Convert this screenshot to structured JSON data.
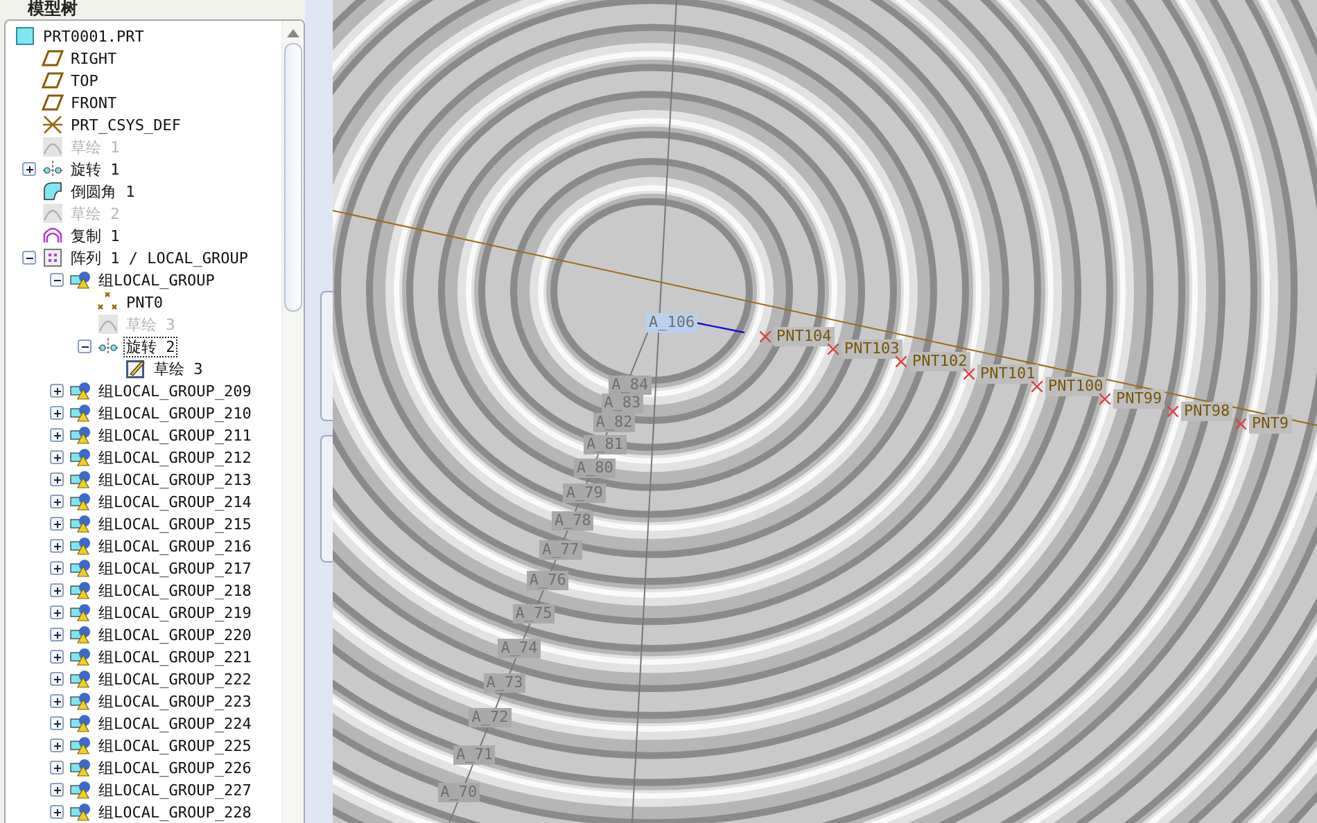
{
  "model_tree": {
    "header": "模型树",
    "items": [
      {
        "label": "PRT0001.PRT",
        "kind": "part",
        "dimmed": false,
        "selected": false,
        "children": [
          {
            "label": "RIGHT",
            "kind": "plane",
            "dimmed": false,
            "selected": false
          },
          {
            "label": "TOP",
            "kind": "plane",
            "dimmed": false,
            "selected": false
          },
          {
            "label": "FRONT",
            "kind": "plane",
            "dimmed": false,
            "selected": false
          },
          {
            "label": "PRT_CSYS_DEF",
            "kind": "csys",
            "dimmed": false,
            "selected": false
          },
          {
            "label": "草绘 1",
            "kind": "sketch",
            "dimmed": true,
            "selected": false
          },
          {
            "label": "旋转 1",
            "kind": "revolve",
            "dimmed": false,
            "selected": false,
            "expanded": false
          },
          {
            "label": "倒圆角 1",
            "kind": "round",
            "dimmed": false,
            "selected": false
          },
          {
            "label": "草绘 2",
            "kind": "sketch",
            "dimmed": true,
            "selected": false
          },
          {
            "label": "复制 1",
            "kind": "copy",
            "dimmed": false,
            "selected": false
          },
          {
            "label": "阵列 1 / LOCAL_GROUP",
            "kind": "pattern",
            "dimmed": false,
            "selected": false,
            "expanded": true,
            "children": [
              {
                "label": "组LOCAL_GROUP",
                "kind": "group",
                "dimmed": false,
                "selected": false,
                "expanded": true,
                "children": [
                  {
                    "label": "PNT0",
                    "kind": "point",
                    "dimmed": false,
                    "selected": false
                  },
                  {
                    "label": "草绘 3",
                    "kind": "sketch",
                    "dimmed": true,
                    "selected": false
                  },
                  {
                    "label": "旋转 2",
                    "kind": "revolve",
                    "dimmed": false,
                    "selected": true,
                    "expanded": true,
                    "children": [
                      {
                        "label": "草绘 3",
                        "kind": "sketch_edit",
                        "dimmed": false,
                        "selected": false
                      }
                    ]
                  }
                ]
              },
              {
                "label": "组LOCAL_GROUP_209",
                "kind": "group",
                "dimmed": false,
                "selected": false,
                "expanded": false
              },
              {
                "label": "组LOCAL_GROUP_210",
                "kind": "group",
                "dimmed": false,
                "selected": false,
                "expanded": false
              },
              {
                "label": "组LOCAL_GROUP_211",
                "kind": "group",
                "dimmed": false,
                "selected": false,
                "expanded": false
              },
              {
                "label": "组LOCAL_GROUP_212",
                "kind": "group",
                "dimmed": false,
                "selected": false,
                "expanded": false
              },
              {
                "label": "组LOCAL_GROUP_213",
                "kind": "group",
                "dimmed": false,
                "selected": false,
                "expanded": false
              },
              {
                "label": "组LOCAL_GROUP_214",
                "kind": "group",
                "dimmed": false,
                "selected": false,
                "expanded": false
              },
              {
                "label": "组LOCAL_GROUP_215",
                "kind": "group",
                "dimmed": false,
                "selected": false,
                "expanded": false
              },
              {
                "label": "组LOCAL_GROUP_216",
                "kind": "group",
                "dimmed": false,
                "selected": false,
                "expanded": false
              },
              {
                "label": "组LOCAL_GROUP_217",
                "kind": "group",
                "dimmed": false,
                "selected": false,
                "expanded": false
              },
              {
                "label": "组LOCAL_GROUP_218",
                "kind": "group",
                "dimmed": false,
                "selected": false,
                "expanded": false
              },
              {
                "label": "组LOCAL_GROUP_219",
                "kind": "group",
                "dimmed": false,
                "selected": false,
                "expanded": false
              },
              {
                "label": "组LOCAL_GROUP_220",
                "kind": "group",
                "dimmed": false,
                "selected": false,
                "expanded": false
              },
              {
                "label": "组LOCAL_GROUP_221",
                "kind": "group",
                "dimmed": false,
                "selected": false,
                "expanded": false
              },
              {
                "label": "组LOCAL_GROUP_222",
                "kind": "group",
                "dimmed": false,
                "selected": false,
                "expanded": false
              },
              {
                "label": "组LOCAL_GROUP_223",
                "kind": "group",
                "dimmed": false,
                "selected": false,
                "expanded": false
              },
              {
                "label": "组LOCAL_GROUP_224",
                "kind": "group",
                "dimmed": false,
                "selected": false,
                "expanded": false
              },
              {
                "label": "组LOCAL_GROUP_225",
                "kind": "group",
                "dimmed": false,
                "selected": false,
                "expanded": false
              },
              {
                "label": "组LOCAL_GROUP_226",
                "kind": "group",
                "dimmed": false,
                "selected": false,
                "expanded": false
              },
              {
                "label": "组LOCAL_GROUP_227",
                "kind": "group",
                "dimmed": false,
                "selected": false,
                "expanded": false
              },
              {
                "label": "组LOCAL_GROUP_228",
                "kind": "group",
                "dimmed": false,
                "selected": false,
                "expanded": false
              }
            ]
          }
        ]
      }
    ]
  },
  "viewport": {
    "axis_labels": [
      {
        "label": "A_106",
        "selected": true
      },
      {
        "label": "A_84",
        "selected": false
      },
      {
        "label": "A_83",
        "selected": false
      },
      {
        "label": "A_82",
        "selected": false
      },
      {
        "label": "A_81",
        "selected": false
      },
      {
        "label": "A_80",
        "selected": false
      },
      {
        "label": "A_79",
        "selected": false
      },
      {
        "label": "A_78",
        "selected": false
      },
      {
        "label": "A_77",
        "selected": false
      },
      {
        "label": "A_76",
        "selected": false
      },
      {
        "label": "A_75",
        "selected": false
      },
      {
        "label": "A_74",
        "selected": false
      },
      {
        "label": "A_73",
        "selected": false
      },
      {
        "label": "A_72",
        "selected": false
      },
      {
        "label": "A_71",
        "selected": false
      },
      {
        "label": "A_70",
        "selected": false
      }
    ],
    "point_labels": [
      "PNT104",
      "PNT103",
      "PNT102",
      "PNT101",
      "PNT100",
      "PNT99",
      "PNT98",
      "PNT9"
    ]
  }
}
